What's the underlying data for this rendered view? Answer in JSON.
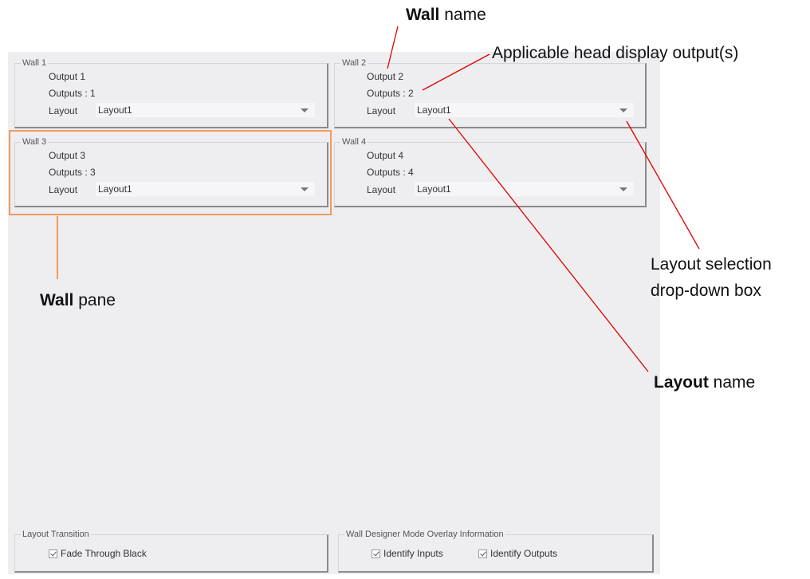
{
  "walls": [
    {
      "title": "Wall 1",
      "output": "Output 1",
      "outputs": "Outputs : 1",
      "layout_label": "Layout",
      "layout_value": "Layout1"
    },
    {
      "title": "Wall 2",
      "output": "Output 2",
      "outputs": "Outputs : 2",
      "layout_label": "Layout",
      "layout_value": "Layout1"
    },
    {
      "title": "Wall 3",
      "output": "Output 3",
      "outputs": "Outputs : 3",
      "layout_label": "Layout",
      "layout_value": "Layout1"
    },
    {
      "title": "Wall 4",
      "output": "Output 4",
      "outputs": "Outputs : 4",
      "layout_label": "Layout",
      "layout_value": "Layout1"
    }
  ],
  "layout_transition": {
    "title": "Layout Transition",
    "fade_label": "Fade Through Black",
    "fade_checked": true
  },
  "overlay_info": {
    "title": "Wall Designer Mode Overlay Information",
    "inputs_label": "Identify Inputs",
    "inputs_checked": true,
    "outputs_label": "Identify Outputs",
    "outputs_checked": true
  },
  "annotations": {
    "wall_name_bold": "Wall",
    "wall_name_rest": " name",
    "head_output": "Applicable head display output(s)",
    "selection_line1": "Layout selection",
    "selection_line2": "drop-down box",
    "wall_pane_bold": "Wall",
    "wall_pane_rest": " pane",
    "layout_name_bold": "Layout",
    "layout_name_rest": " name"
  },
  "colors": {
    "annotation_line": "#e00000",
    "highlight": "#f29b5e",
    "background": "#eeeef0"
  }
}
